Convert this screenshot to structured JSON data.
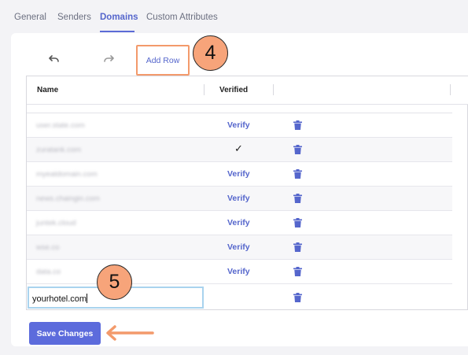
{
  "tabs": [
    {
      "label": "General",
      "active": false
    },
    {
      "label": "Senders",
      "active": false
    },
    {
      "label": "Domains",
      "active": true
    },
    {
      "label": "Custom Attributes",
      "active": false
    }
  ],
  "toolbar": {
    "undo_icon": "undo-icon",
    "redo_icon": "redo-icon",
    "add_row_label": "Add Row"
  },
  "annotations": {
    "step_4": "4",
    "step_5": "5",
    "highlight_color": "#f39a6b"
  },
  "grid": {
    "columns": [
      "Name",
      "Verified"
    ],
    "rows": [
      {
        "name": "user.state.com",
        "verified": "Verify",
        "delete_icon": "trash-icon"
      },
      {
        "name": "zuratank.com",
        "verified": "✓",
        "delete_icon": "trash-icon"
      },
      {
        "name": "myeatdomain.com",
        "verified": "Verify",
        "delete_icon": "trash-icon"
      },
      {
        "name": "news.chaingin.com",
        "verified": "Verify",
        "delete_icon": "trash-icon"
      },
      {
        "name": "juntek.cloud",
        "verified": "Verify",
        "delete_icon": "trash-icon"
      },
      {
        "name": "wse.co",
        "verified": "Verify",
        "delete_icon": "trash-icon"
      },
      {
        "name": "data.co",
        "verified": "Verify",
        "delete_icon": "trash-icon"
      }
    ],
    "editing_row": {
      "value": "yourhotel.com",
      "delete_icon": "trash-icon"
    }
  },
  "footer": {
    "save_label": "Save Changes"
  },
  "colors": {
    "accent": "#5c6bdc",
    "link": "#5566cc",
    "badge": "#f7a47a"
  }
}
